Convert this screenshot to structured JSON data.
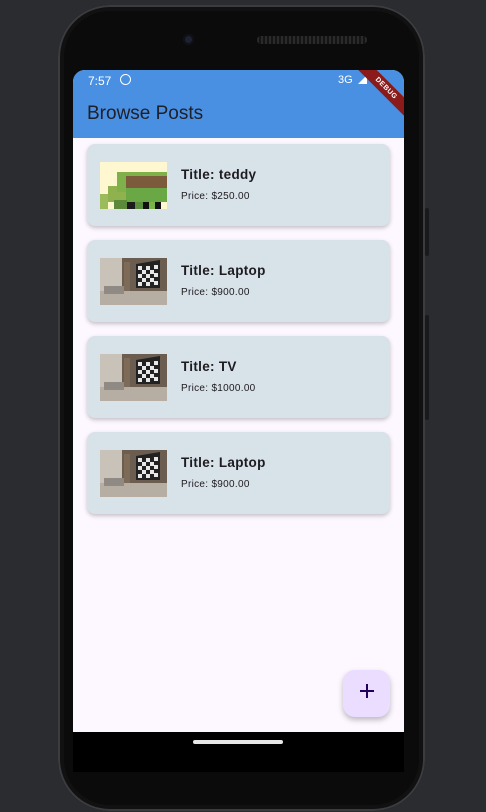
{
  "status_bar": {
    "time": "7:57",
    "network": "3G"
  },
  "app_bar": {
    "title": "Browse Posts"
  },
  "debug_banner": {
    "label": "DEBUG"
  },
  "posts": [
    {
      "title": "Title: teddy",
      "price": "Price: $250.00",
      "thumbnail": "teddy-image"
    },
    {
      "title": "Title: Laptop",
      "price": "Price: $900.00",
      "thumbnail": "room-image"
    },
    {
      "title": "Title: TV",
      "price": "Price: $1000.00",
      "thumbnail": "room-image"
    },
    {
      "title": "Title: Laptop",
      "price": "Price: $900.00",
      "thumbnail": "room-image"
    }
  ],
  "fab": {
    "icon": "plus-icon"
  },
  "colors": {
    "app_bar": "#4a90e2",
    "card": "#d8e2e9",
    "fab": "#eaddff",
    "debug_ribbon": "#8b1a1a"
  }
}
